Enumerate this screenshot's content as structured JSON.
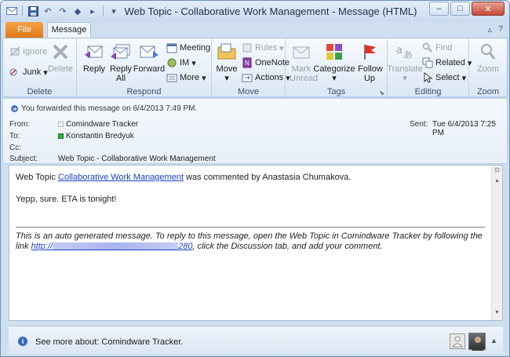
{
  "window": {
    "title": "Web Topic - Collaborative Work Management  -  Message (HTML)"
  },
  "tabs": {
    "file": "File",
    "message": "Message"
  },
  "ribbon": {
    "delete_group": {
      "label": "Delete",
      "ignore": "Ignore",
      "junk": "Junk",
      "delete": "Delete"
    },
    "respond_group": {
      "label": "Respond",
      "reply": "Reply",
      "reply_all": "Reply All",
      "forward": "Forward",
      "meeting": "Meeting",
      "im": "IM",
      "more": "More"
    },
    "move_group": {
      "label": "Move",
      "move": "Move",
      "rules": "Rules",
      "onenote": "OneNote",
      "actions": "Actions"
    },
    "tags_group": {
      "label": "Tags",
      "mark_unread": "Mark Unread",
      "categorize": "Categorize",
      "follow_up": "Follow Up"
    },
    "editing_group": {
      "label": "Editing",
      "translate": "Translate",
      "find": "Find",
      "related": "Related",
      "select": "Select"
    },
    "zoom_group": {
      "label": "Zoom",
      "zoom": "Zoom"
    }
  },
  "header": {
    "info": "You forwarded this message on 6/4/2013 7:49 PM.",
    "from_label": "From:",
    "from_value": "Comindware Tracker",
    "to_label": "To:",
    "to_value": "Konstantin Bredyuk",
    "cc_label": "Cc:",
    "subject_label": "Subject:",
    "subject_value": "Web Topic - Collaborative Work Management",
    "sent_label": "Sent:",
    "sent_value": "Tue 6/4/2013 7:25 PM"
  },
  "body": {
    "line1_prefix": "Web Topic ",
    "line1_link": "Collaborative Work Management",
    "line1_suffix": " was commented by Anastasia Chumakova.",
    "line2": "Yepp, sure. ETA is tonight!",
    "auto_prefix": "This is an auto generated message. To reply to this message, open the Web Topic in Comindware Tracker by following the link ",
    "auto_link_start": "http://",
    "auto_link_end": "280",
    "auto_suffix": ", click the Discussion tab, and add your comment."
  },
  "people_pane": {
    "see_more": "See more about: Comindware Tracker."
  },
  "colors": {
    "file_tab": "#e27712",
    "link": "#1a3fcc",
    "accent": "#4a75c2"
  }
}
